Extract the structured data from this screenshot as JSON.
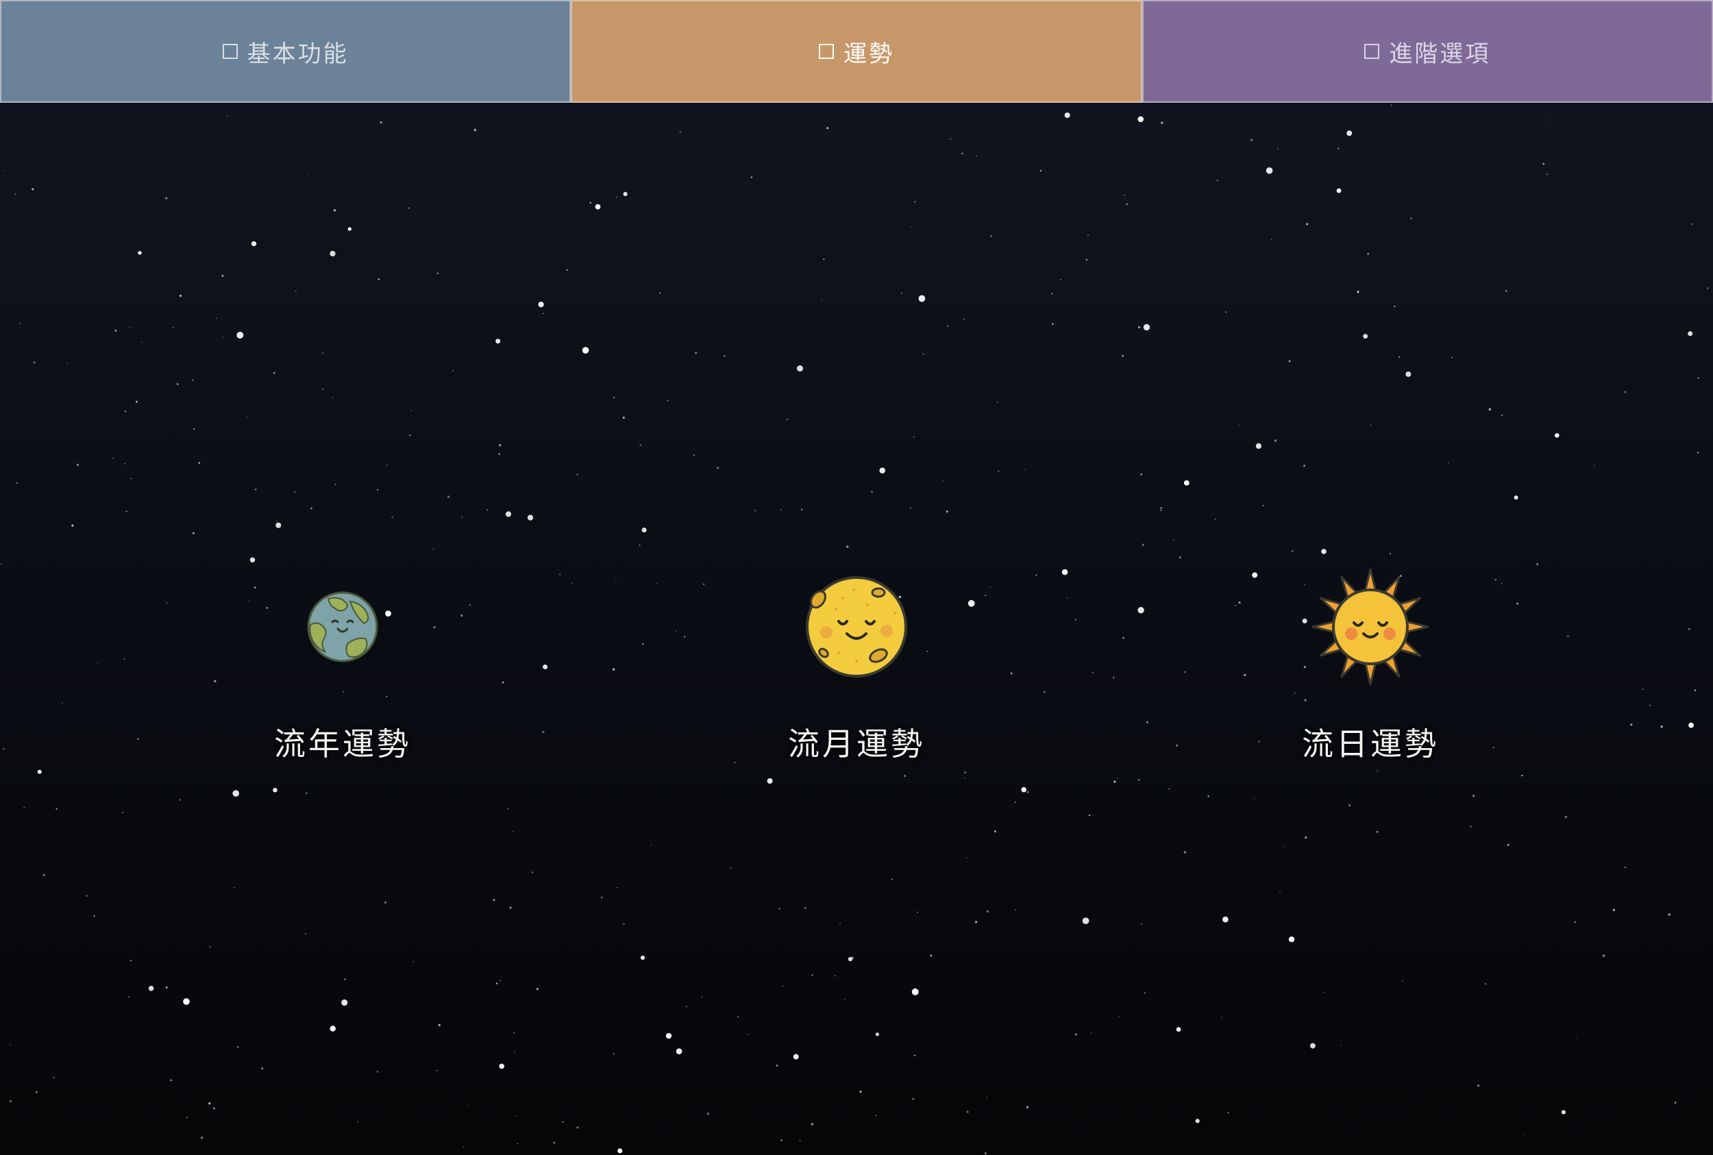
{
  "nav": {
    "tabs": [
      {
        "id": "basic",
        "label": "基本功能",
        "color": "#6b8299",
        "text_color": "#d9dee5",
        "active": false
      },
      {
        "id": "fortune",
        "label": "運勢",
        "color": "#c89769",
        "text_color": "#ffffff",
        "active": true
      },
      {
        "id": "advanced",
        "label": "進階選項",
        "color": "#7e6997",
        "text_color": "#dcd5e6",
        "active": false
      }
    ]
  },
  "main": {
    "features": [
      {
        "label": "流年運勢",
        "icon": "earth-icon"
      },
      {
        "label": "流月運勢",
        "icon": "moon-icon"
      },
      {
        "label": "流日運勢",
        "icon": "sun-icon"
      }
    ]
  },
  "colors": {
    "background_top": "#111622",
    "background_bottom": "#050608",
    "star": "#ffffff"
  }
}
